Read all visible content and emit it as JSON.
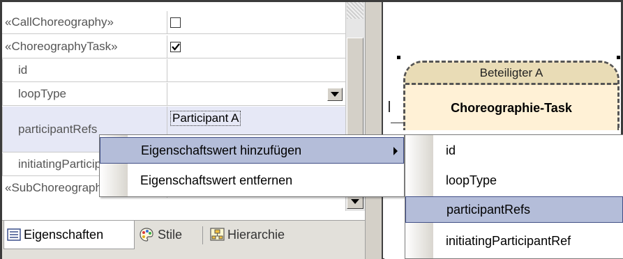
{
  "properties": {
    "rows": [
      {
        "name": "«CallChoreography»",
        "checked": false
      },
      {
        "name": "«ChoreographyTask»",
        "checked": true
      },
      {
        "name": "id",
        "value": ""
      },
      {
        "name": "loopType",
        "value": ""
      },
      {
        "name": "participantRefs",
        "value": "Participant A"
      },
      {
        "name": "initiatingParticipantRef",
        "value": ""
      },
      {
        "name": "«SubChoreography»",
        "value": ""
      }
    ]
  },
  "context_menu": {
    "items": [
      {
        "label": "Eigenschaftswert hinzufügen",
        "has_submenu": true,
        "selected": true
      },
      {
        "label": "Eigenschaftswert entfernen",
        "has_submenu": false,
        "selected": false
      }
    ]
  },
  "submenu": {
    "items": [
      {
        "label": "id",
        "selected": false
      },
      {
        "label": "loopType",
        "selected": false
      },
      {
        "label": "participantRefs",
        "selected": true
      },
      {
        "label": "initiatingParticipantRef",
        "selected": false
      }
    ]
  },
  "tabs": [
    {
      "label": "Eigenschaften",
      "icon": "list-icon",
      "active": true
    },
    {
      "label": "Stile",
      "icon": "palette-icon",
      "active": false
    },
    {
      "label": "Hierarchie",
      "icon": "hierarchy-icon",
      "active": false
    }
  ],
  "diagram": {
    "participant_band": "Beteiligter A",
    "task_name": "Choreographie-Task"
  },
  "colors": {
    "menu_selection": "#b4bdd9",
    "menu_selection_border": "#414f86",
    "participant_band": "#e9dcb6",
    "task_body": "#fff1d6"
  }
}
